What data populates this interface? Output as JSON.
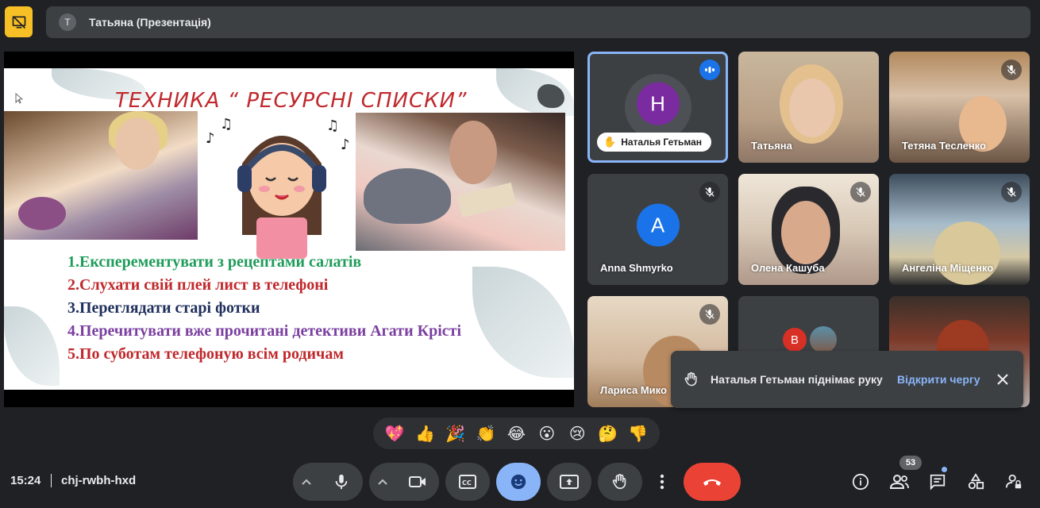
{
  "top_bar": {
    "presenter_initial": "T",
    "presenter_label": "Татьяна (Презентація)"
  },
  "slide": {
    "title": "ТЕХНИКА “ РЕСУРСНІ СПИСКИ”",
    "items": [
      {
        "text": "1.Експерементувати з рецептами салатів",
        "color": "#1f9c5a"
      },
      {
        "text": "2.Слухати свій плей лист в телефоні",
        "color": "#c0282c"
      },
      {
        "text": "3.Переглядати старі фотки",
        "color": "#1f2f5c"
      },
      {
        "text": "4.Перечитувати вже прочитані детективи Агати Крісті",
        "color": "#7b3fa0"
      },
      {
        "text": "5.По суботам  телефоную всім родичам",
        "color": "#c0282c"
      }
    ]
  },
  "participants": [
    {
      "name": "Наталья Гетьман",
      "initial": "Н",
      "avatar_color": "#7b2ba0",
      "muted": false,
      "speaking": true,
      "hand_raised": true,
      "video": false
    },
    {
      "name": "Татьяна",
      "muted": false,
      "video": true
    },
    {
      "name": "Тетяна Тесленко",
      "muted": true,
      "video": true
    },
    {
      "name": "Anna Shmyrko",
      "initial": "A",
      "avatar_color": "#1a73e8",
      "muted": true,
      "video": false
    },
    {
      "name": "Олена Кашуба",
      "muted": true,
      "video": true
    },
    {
      "name": "Ангеліна Міщенко",
      "muted": true,
      "video": true
    },
    {
      "name": "Лариса Мико",
      "muted": true,
      "video": true
    },
    {
      "name": "",
      "initial": "B",
      "avatar_color": "#d93025",
      "muted": false,
      "video": false
    },
    {
      "name": "",
      "muted": false,
      "video": true
    }
  ],
  "toast": {
    "message": "Наталья Гетьман піднімає руку",
    "action": "Відкрити чергу"
  },
  "reactions": [
    "💖",
    "👍",
    "🎉",
    "👏",
    "😂",
    "😮",
    "😢",
    "🤔",
    "👎"
  ],
  "bottom_bar": {
    "time": "15:24",
    "meeting_code": "chj-rwbh-hxd",
    "people_count": "53"
  },
  "colors": {
    "accent": "#8ab4f8",
    "end_call": "#ea4335",
    "stop_presenting": "#f6c026"
  }
}
